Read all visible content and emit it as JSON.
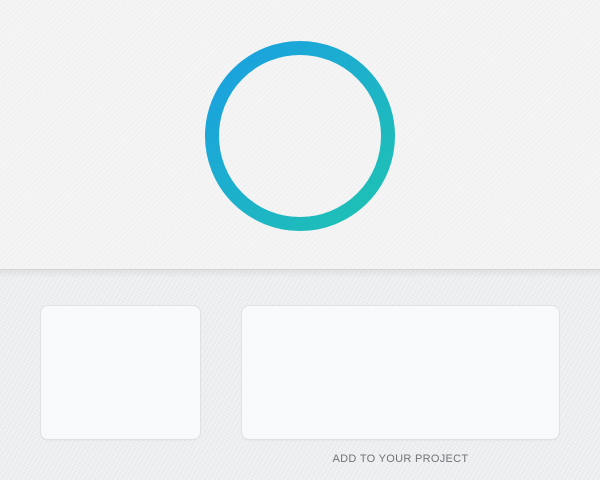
{
  "preview": {
    "ring_gradient_start": "#1a9fe3",
    "ring_gradient_end": "#1fc3b1"
  },
  "panel": {
    "caption": "ADD TO YOUR PROJECT"
  }
}
